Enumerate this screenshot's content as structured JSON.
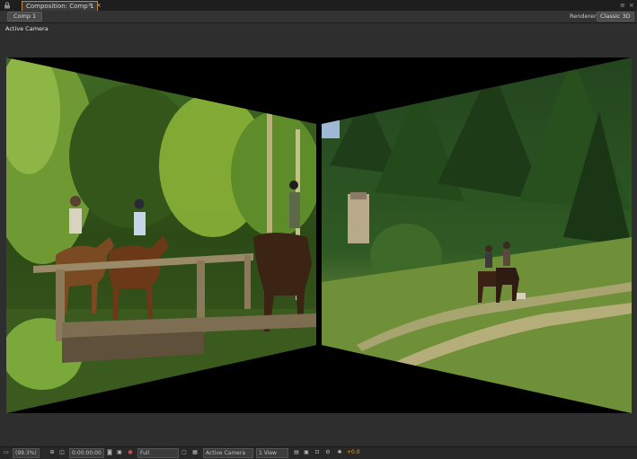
{
  "tabs": {
    "panel_title": "Composition: Comp 1",
    "lock_icon": "lock-icon",
    "menu_glyph": "≡",
    "close_glyph": "×"
  },
  "subbar": {
    "comp_button": "Comp 1",
    "renderer_label": "Renderer:",
    "renderer_value": "Classic 3D"
  },
  "viewer": {
    "view_label": "Active Camera",
    "scene": {
      "left_panel": "3D layer: riders on horses crossing a wooden bridge in a forest",
      "right_panel": "3D layer: two riders on a meadow path in front of a spruce forest"
    }
  },
  "bottom_bar": {
    "magnification": "(99.3%)",
    "timecode": "0:00:00:00",
    "resolution": "Full",
    "camera_view": "Active Camera",
    "views": "1 View",
    "exposure": "+0.0",
    "accent_color": "#e8a21a"
  }
}
